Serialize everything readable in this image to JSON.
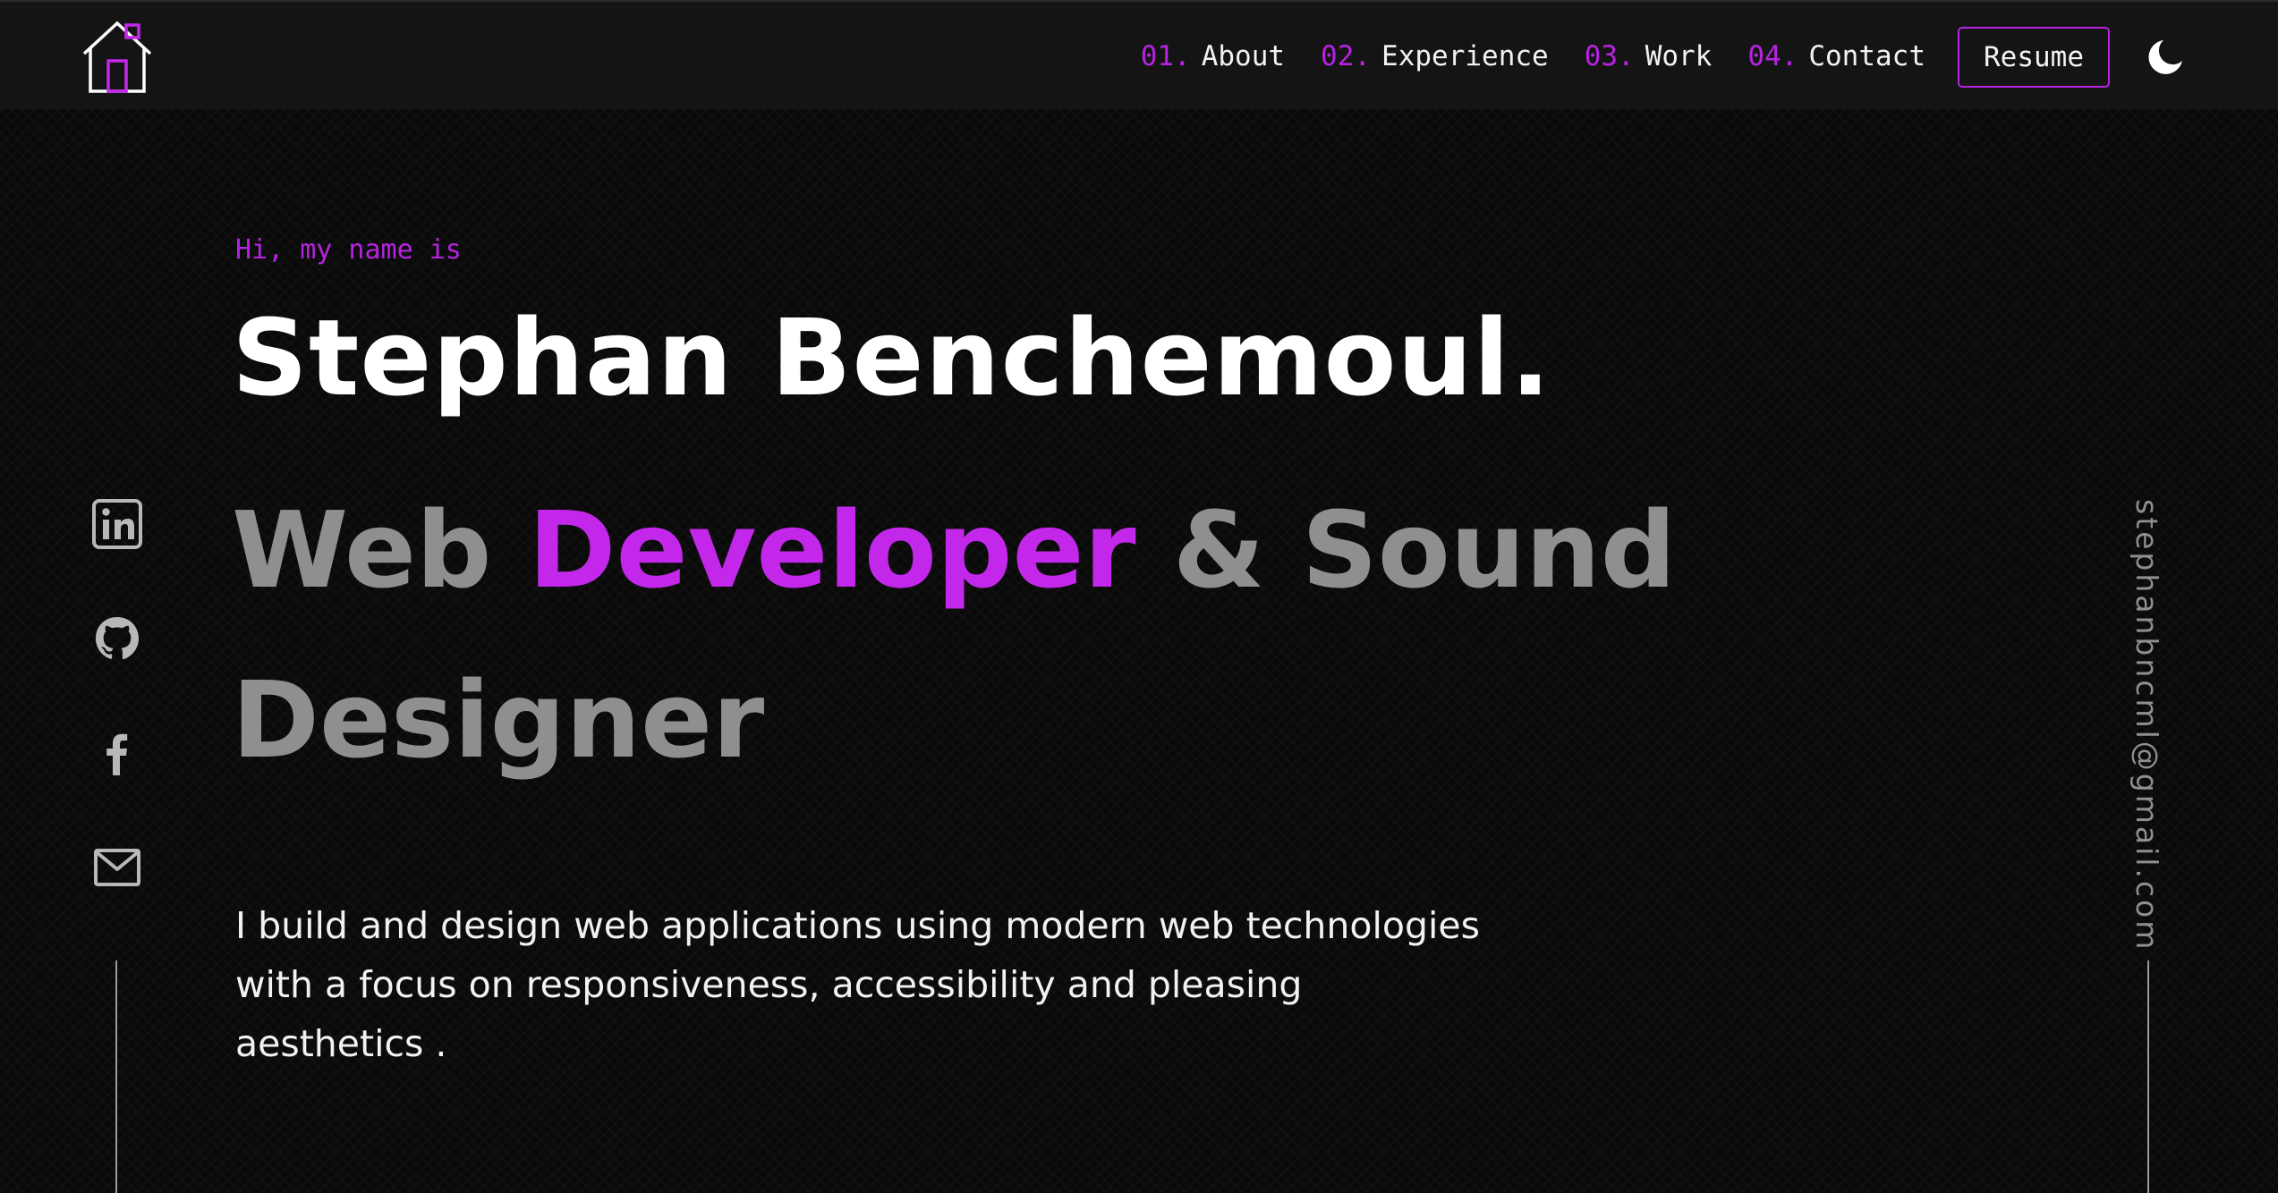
{
  "nav": {
    "items": [
      {
        "num": "01.",
        "label": "About"
      },
      {
        "num": "02.",
        "label": "Experience"
      },
      {
        "num": "03.",
        "label": "Work"
      },
      {
        "num": "04.",
        "label": "Contact"
      }
    ],
    "resume_label": "Resume",
    "logo_icon": "house-icon",
    "theme_icon": "moon-icon"
  },
  "hero": {
    "greeting": "Hi, my name is",
    "name": "Stephan Benchemoul.",
    "role_part1": "Web ",
    "role_accent": "Developer",
    "role_part2": " & Sound Designer",
    "description": "I build and design web applications using modern web technologies with a focus on responsiveness, accessibility and pleasing aesthetics ."
  },
  "social": [
    {
      "name": "linkedin",
      "icon": "linkedin-icon"
    },
    {
      "name": "github",
      "icon": "github-icon"
    },
    {
      "name": "facebook",
      "icon": "facebook-icon"
    },
    {
      "name": "email",
      "icon": "mail-icon"
    }
  ],
  "email": "stephanbncml@gmail.com",
  "colors": {
    "accent": "#b623e0",
    "background": "#0a0a0a",
    "nav_background": "#141414",
    "muted_text": "#8f8f8f",
    "text": "#f2f2f2"
  }
}
